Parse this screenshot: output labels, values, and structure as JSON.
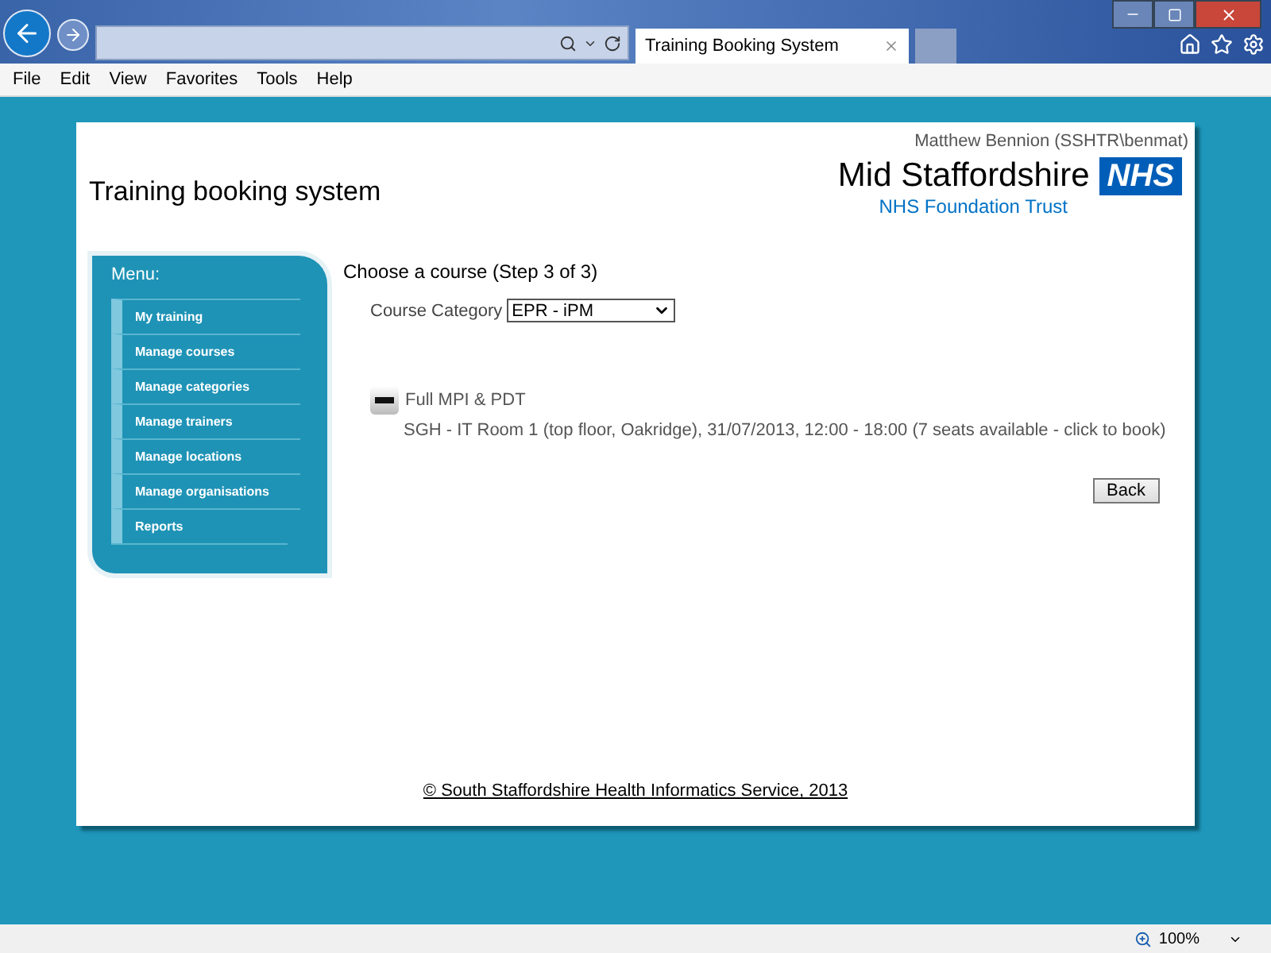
{
  "browser": {
    "tab_title": "Training Booking System",
    "menu": [
      "File",
      "Edit",
      "View",
      "Favorites",
      "Tools",
      "Help"
    ],
    "zoom": "100%"
  },
  "page": {
    "user": "Matthew Bennion (SSHTR\\benmat)",
    "title": "Training booking system",
    "logo": {
      "name": "Mid Staffordshire",
      "badge": "NHS",
      "subtitle": "NHS Foundation Trust"
    },
    "menu": {
      "heading": "Menu:",
      "items": [
        "My training",
        "Manage courses",
        "Manage categories",
        "Manage trainers",
        "Manage locations",
        "Manage organisations",
        "Reports"
      ]
    },
    "heading": "Choose a course (Step 3 of 3)",
    "category": {
      "label": "Course Category",
      "value": "EPR - iPM"
    },
    "courses": [
      {
        "name": "Full MPI & PDT",
        "expanded": true,
        "sessions": [
          "SGH - IT Room 1 (top floor, Oakridge), 31/07/2013, 12:00 - 18:00 (7 seats available - click to book)"
        ]
      }
    ],
    "back": "Back",
    "footer": "© South Staffordshire Health Informatics Service, 2013"
  }
}
